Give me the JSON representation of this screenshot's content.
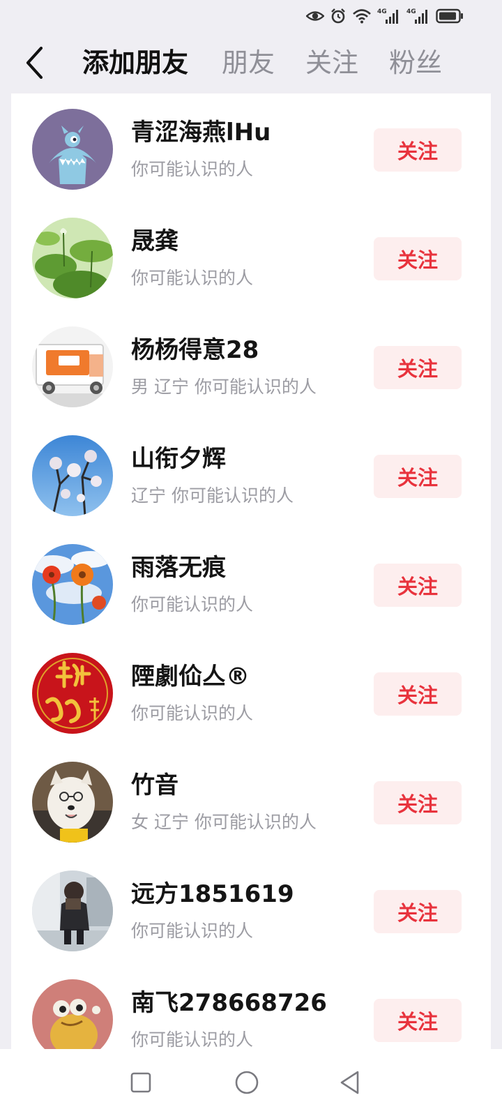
{
  "status_bar": {
    "icons": [
      "eye-icon",
      "alarm-icon",
      "wifi-icon",
      "signal-4g-icon",
      "signal-4g-icon",
      "battery-icon"
    ],
    "network_labels": [
      "4G",
      "4G"
    ]
  },
  "header": {
    "tabs": [
      {
        "label": "添加朋友",
        "active": true
      },
      {
        "label": "朋友",
        "active": false
      },
      {
        "label": "关注",
        "active": false
      },
      {
        "label": "粉丝",
        "active": false
      }
    ]
  },
  "users": [
    {
      "name": "青涩海燕lHu",
      "subtitle": "你可能认识的人",
      "follow_label": "关注",
      "avatar": "cartoon-monster"
    },
    {
      "name": "晟龚",
      "subtitle": "你可能认识的人",
      "follow_label": "关注",
      "avatar": "lotus-leaves"
    },
    {
      "name": "杨杨得意28",
      "subtitle": "男 辽宁 你可能认识的人",
      "follow_label": "关注",
      "avatar": "delivery-truck"
    },
    {
      "name": "山衔夕辉",
      "subtitle": "辽宁 你可能认识的人",
      "follow_label": "关注",
      "avatar": "blossom-branches"
    },
    {
      "name": "雨落无痕",
      "subtitle": "你可能认识的人",
      "follow_label": "关注",
      "avatar": "red-flowers-sky"
    },
    {
      "name": "陻劇佡亼®",
      "subtitle": "你可能认识的人",
      "follow_label": "关注",
      "avatar": "red-calligraphy"
    },
    {
      "name": "竹音",
      "subtitle": "女 辽宁 你可能认识的人",
      "follow_label": "关注",
      "avatar": "white-dog"
    },
    {
      "name": "远方1851619",
      "subtitle": "你可能认识的人",
      "follow_label": "关注",
      "avatar": "child-photo"
    },
    {
      "name": "南飞278668726",
      "subtitle": "你可能认识的人",
      "follow_label": "关注",
      "avatar": "cartoon-frog"
    }
  ],
  "colors": {
    "follow_text": "#e8333d",
    "follow_bg": "#fdeeee",
    "subtitle": "#9c9ca3",
    "page_bg": "#efeef3"
  },
  "nav_bar": {
    "buttons": [
      "recent-apps-button",
      "home-button",
      "back-nav-button"
    ]
  }
}
